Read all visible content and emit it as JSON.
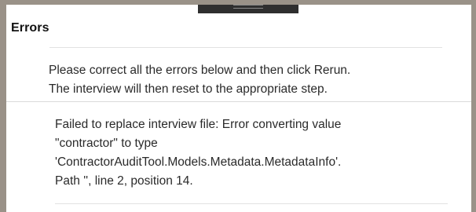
{
  "dialog": {
    "title": "Errors",
    "instructions": [
      "Please correct all the errors below and then click Rerun.",
      "The interview will then reset to the appropriate step."
    ],
    "errors": [
      {
        "lines": [
          "Failed to replace interview file: Error converting value",
          "\"contractor\" to type",
          "'ContractorAuditTool.Models.Metadata.MetadataInfo'.",
          "Path '', line 2, position 14."
        ]
      }
    ]
  }
}
